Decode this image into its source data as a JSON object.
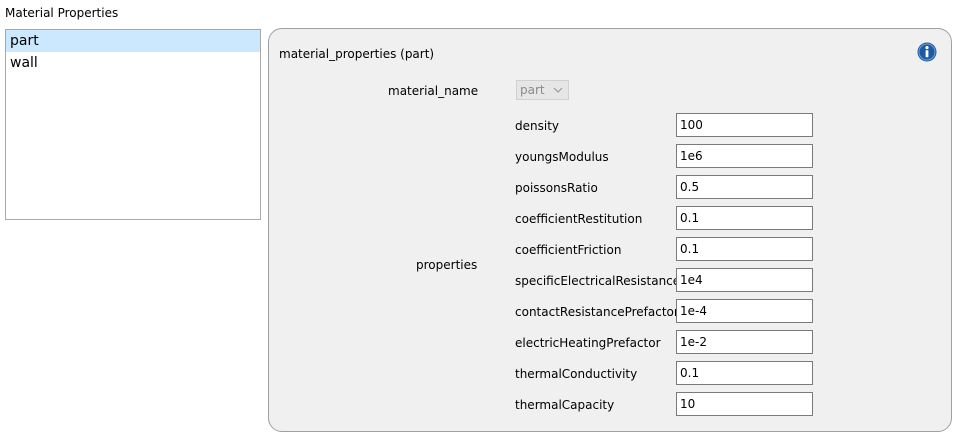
{
  "header": {
    "title": "Material Properties"
  },
  "material_list": {
    "items": [
      {
        "label": "part",
        "selected": true
      },
      {
        "label": "wall",
        "selected": false
      }
    ]
  },
  "panel": {
    "title": "material_properties (part)",
    "info_icon": "info-icon",
    "material_name": {
      "label": "material_name",
      "value": "part",
      "enabled": false
    },
    "properties_label": "properties",
    "properties": [
      {
        "label": "density",
        "value": "100"
      },
      {
        "label": "youngsModulus",
        "value": "1e6"
      },
      {
        "label": "poissonsRatio",
        "value": "0.5"
      },
      {
        "label": "coefficientRestitution",
        "value": "0.1"
      },
      {
        "label": "coefficientFriction",
        "value": "0.1"
      },
      {
        "label": "specificElectricalResistance",
        "value": "1e4"
      },
      {
        "label": "contactResistancePrefactor",
        "value": "1e-4"
      },
      {
        "label": "electricHeatingPrefactor",
        "value": "1e-2"
      },
      {
        "label": "thermalConductivity",
        "value": "0.1"
      },
      {
        "label": "thermalCapacity",
        "value": "10"
      }
    ]
  },
  "colors": {
    "selection": "#cce8ff",
    "panel_bg": "#f0f0f0",
    "info_blue": "#1e5aa0"
  }
}
